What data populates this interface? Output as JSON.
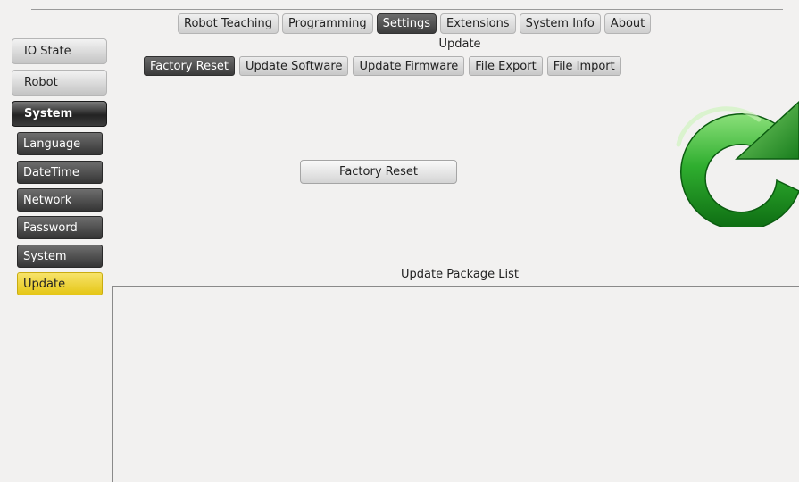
{
  "top_nav": {
    "tabs": [
      "Robot Teaching",
      "Programming",
      "Settings",
      "Extensions",
      "System Info",
      "About"
    ],
    "active": "Settings"
  },
  "section_title": "Update",
  "sub_nav": {
    "tabs": [
      "Factory Reset",
      "Update Software",
      "Update Firmware",
      "File Export",
      "File Import"
    ],
    "active": "Factory Reset"
  },
  "sidebar": {
    "main_items": [
      "IO State",
      "Robot",
      "System"
    ],
    "active_main": "System",
    "sub_items": [
      "Language",
      "DateTime",
      "Network",
      "Password",
      "System",
      "Update"
    ],
    "active_sub": "Update"
  },
  "main": {
    "factory_reset_button": "Factory Reset",
    "icon": "refresh-arrow-icon",
    "list_title": "Update Package List",
    "packages": []
  },
  "colors": {
    "active_dark": "#3d3d3d",
    "active_yellow": "#e5c616",
    "icon_green": "#1e9a1e"
  }
}
